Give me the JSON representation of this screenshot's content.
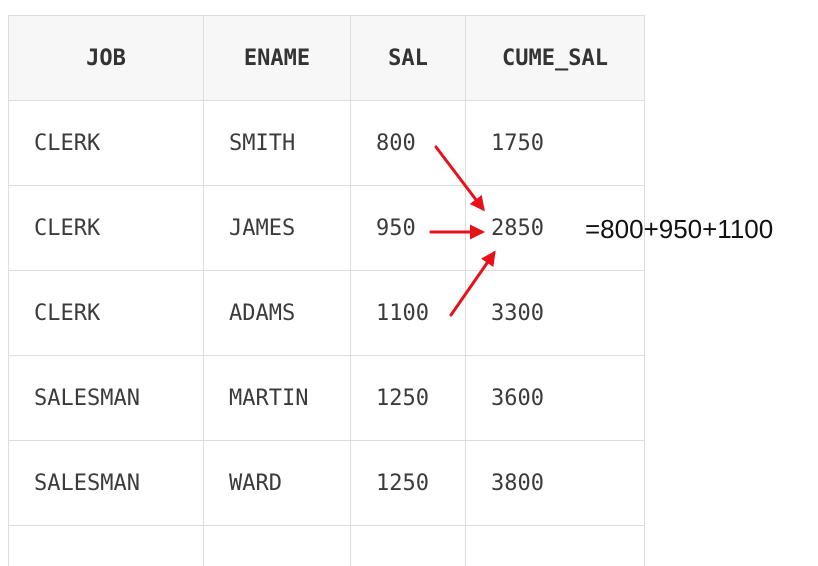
{
  "table": {
    "columns": [
      "JOB",
      "ENAME",
      "SAL",
      "CUME_SAL"
    ],
    "rows": [
      [
        "CLERK",
        "SMITH",
        "800",
        "1750"
      ],
      [
        "CLERK",
        "JAMES",
        "950",
        "2850"
      ],
      [
        "CLERK",
        "ADAMS",
        "1100",
        "3300"
      ],
      [
        "SALESMAN",
        "MARTIN",
        "1250",
        "3600"
      ],
      [
        "SALESMAN",
        "WARD",
        "1250",
        "3800"
      ]
    ]
  },
  "annotation": {
    "formula": "=800+950+1100",
    "arrow_color": "#e8111a"
  }
}
